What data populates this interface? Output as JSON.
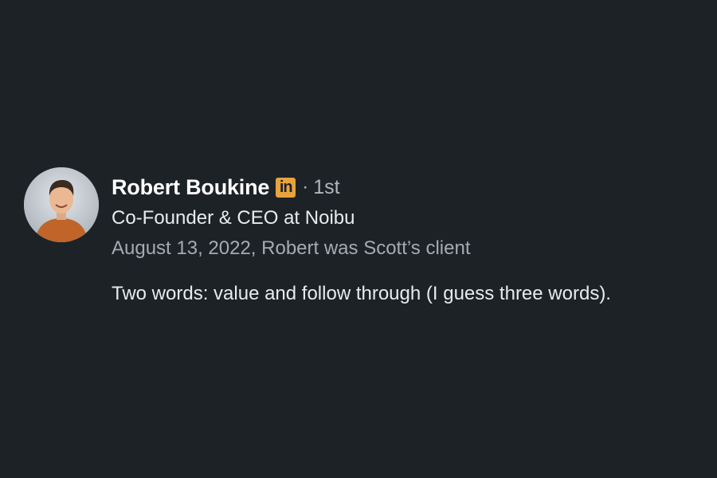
{
  "recommendation": {
    "author": {
      "name": "Robert Boukine",
      "badge_label": "in",
      "separator": "·",
      "connection_degree": "1st",
      "headline": "Co-Founder & CEO at Noibu",
      "avatar_icon": "profile-photo"
    },
    "meta": "August 13, 2022, Robert was Scott’s client",
    "text": "Two words: value and follow through (I guess three words)."
  },
  "colors": {
    "background": "#1d2226",
    "name": "#ffffff",
    "badge": "#e7a33e",
    "secondary_text": "#a4abb2",
    "body_text": "#e9ebed"
  }
}
